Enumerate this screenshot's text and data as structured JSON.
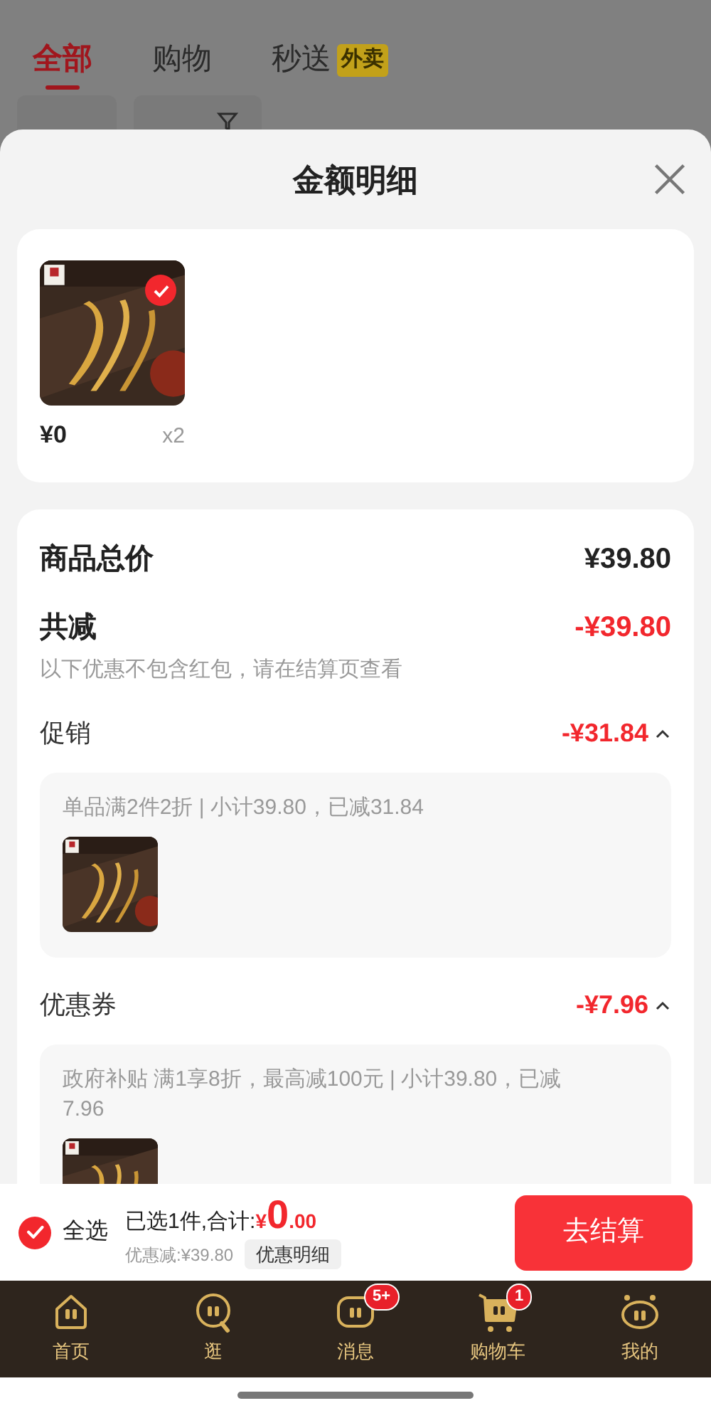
{
  "background": {
    "tabs": [
      {
        "label": "全部",
        "selected": true
      },
      {
        "label": "购物",
        "selected": false
      },
      {
        "label": "秒送",
        "selected": false,
        "badge": "外卖"
      }
    ],
    "chips": [
      {
        "kind": "plain"
      },
      {
        "kind": "filter"
      }
    ]
  },
  "sheet": {
    "title": "金额明细",
    "items": [
      {
        "price": "¥0",
        "qty": "x2",
        "selected": true
      }
    ],
    "total": {
      "label": "商品总价",
      "value": "¥39.80"
    },
    "discount": {
      "label": "共减",
      "value": "-¥39.80",
      "note": "以下优惠不包含红包，请在结算页查看"
    },
    "sections": [
      {
        "label": "促销",
        "value": "-¥31.84",
        "expanded": true,
        "detail": "单品满2件2折 | 小计39.80，已减31.84"
      },
      {
        "label": "优惠券",
        "value": "-¥7.96",
        "expanded": true,
        "detail": "政府补贴 满1享8折，最高减100元 | 小计39.80，已减7.96"
      }
    ]
  },
  "footer": {
    "select_all": {
      "label": "全选",
      "checked": true
    },
    "summary": "已选1件,合计:",
    "currency": "¥",
    "amount_int": "0",
    "amount_dec": ".00",
    "saved": "优惠减:¥39.80",
    "detail_button": "优惠明细",
    "checkout": "去结算"
  },
  "nav": [
    {
      "label": "首页",
      "kind": "home"
    },
    {
      "label": "逛",
      "kind": "browse"
    },
    {
      "label": "消息",
      "kind": "message",
      "badge": "5+"
    },
    {
      "label": "购物车",
      "kind": "cart",
      "badge": "1"
    },
    {
      "label": "我的",
      "kind": "me"
    }
  ]
}
